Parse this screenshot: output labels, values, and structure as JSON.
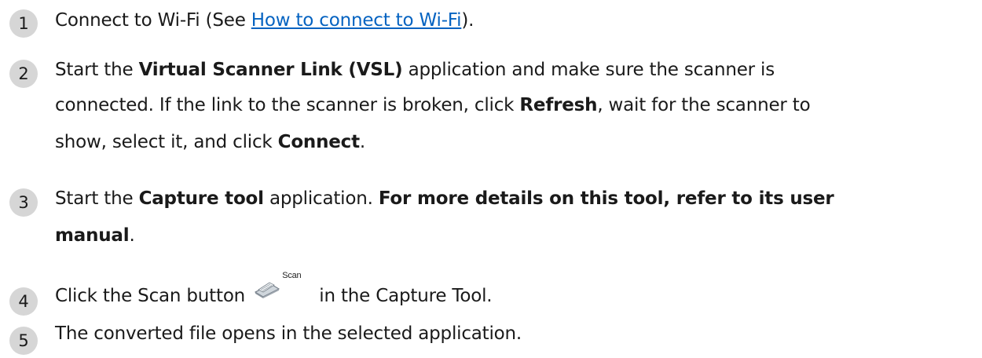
{
  "steps": [
    {
      "number": "1",
      "lines": [
        {
          "t1": "Connect to Wi-Fi (See ",
          "link": "How to connect to Wi-Fi",
          "t2": ")."
        }
      ]
    },
    {
      "number": "2",
      "line1": {
        "t1": "Start the ",
        "b1": "Virtual Scanner Link (VSL)",
        "t2": " application and make sure the scanner is"
      },
      "line2": {
        "t1": "connected. If the link to the scanner is broken, click ",
        "b1": "Refresh",
        "t2": ", wait for the scanner to"
      },
      "line3": {
        "t1": "show, select it, and click ",
        "b1": "Connect",
        "t2": "."
      }
    },
    {
      "number": "3",
      "line1": {
        "t1": "Start the ",
        "b1": "Capture tool",
        "t2": " application. ",
        "b2": "For more details on this tool, refer to its user"
      },
      "line2": {
        "b1": "manual",
        "t1": "."
      }
    },
    {
      "number": "4",
      "line1": {
        "t1": "Click the Scan button ",
        "scan_label": "Scan",
        "t2": " in the Capture Tool."
      }
    },
    {
      "number": "5",
      "line1": {
        "t1": "The converted file opens in the selected application."
      }
    }
  ],
  "colors": {
    "badge_bg": "#d6d6d6",
    "link": "#0563c1",
    "text": "#1a1a1a"
  },
  "icons": {
    "scan_button": "scanner-icon"
  }
}
